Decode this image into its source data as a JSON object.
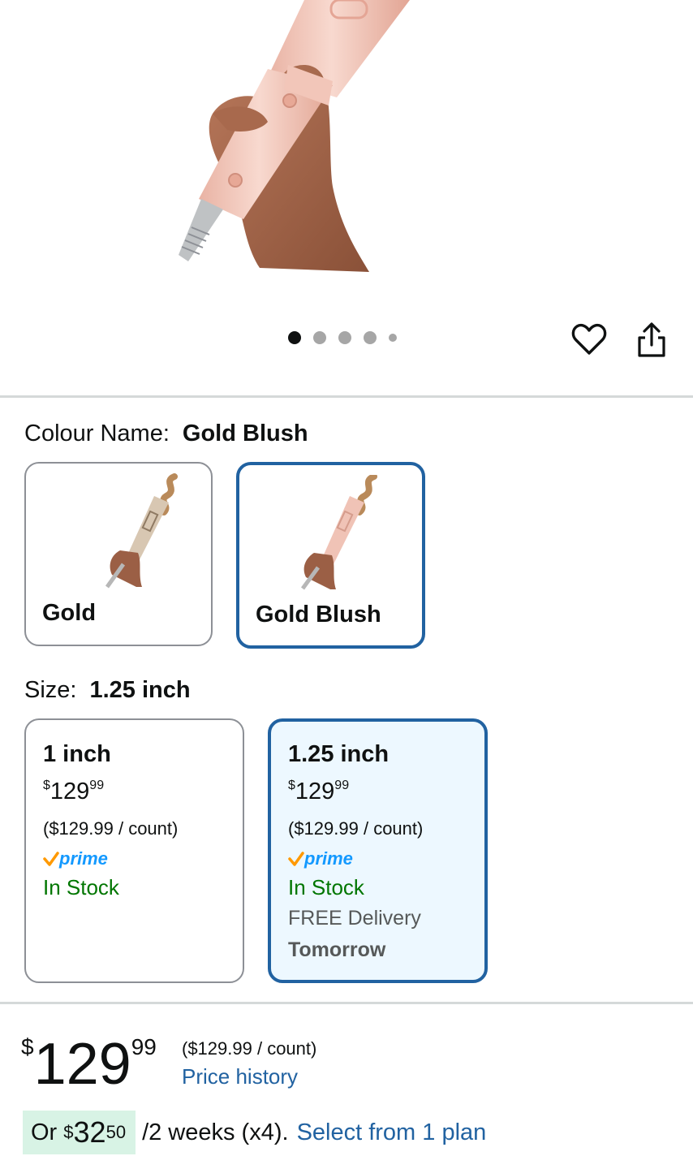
{
  "gallery": {
    "dot_count": 5,
    "active_dot": 0,
    "icons": {
      "wishlist": "heart-outline-icon",
      "share": "share-icon"
    }
  },
  "colour": {
    "label": "Colour Name:",
    "selected_value": "Gold Blush",
    "options": [
      {
        "name": "Gold",
        "selected": false
      },
      {
        "name": "Gold Blush",
        "selected": true
      }
    ]
  },
  "size": {
    "label": "Size:",
    "selected_value": "1.25 inch",
    "options": [
      {
        "name": "1 inch",
        "price_currency": "$",
        "price_whole": "129",
        "price_cents": "99",
        "unit_price": "($129.99 / count)",
        "prime": "prime",
        "stock": "In Stock",
        "selected": false
      },
      {
        "name": "1.25 inch",
        "price_currency": "$",
        "price_whole": "129",
        "price_cents": "99",
        "unit_price": "($129.99 / count)",
        "prime": "prime",
        "stock": "In Stock",
        "delivery": "FREE Delivery",
        "delivery_day": "Tomorrow",
        "selected": true
      }
    ]
  },
  "price": {
    "currency": "$",
    "whole": "129",
    "cents": "99",
    "unit_price": "($129.99 / count)",
    "history_link": "Price history"
  },
  "installment": {
    "prefix": "Or",
    "currency": "$",
    "whole": "32",
    "cents": "50",
    "terms": "/2 weeks (x4).",
    "link": "Select from 1 plan"
  },
  "colors": {
    "link_blue": "#2162a1",
    "selected_border": "#2162a1",
    "in_stock_green": "#007600",
    "prime_blue": "#1399ff",
    "prime_check_orange": "#ff9900",
    "installment_highlight": "#d8f3e5"
  }
}
